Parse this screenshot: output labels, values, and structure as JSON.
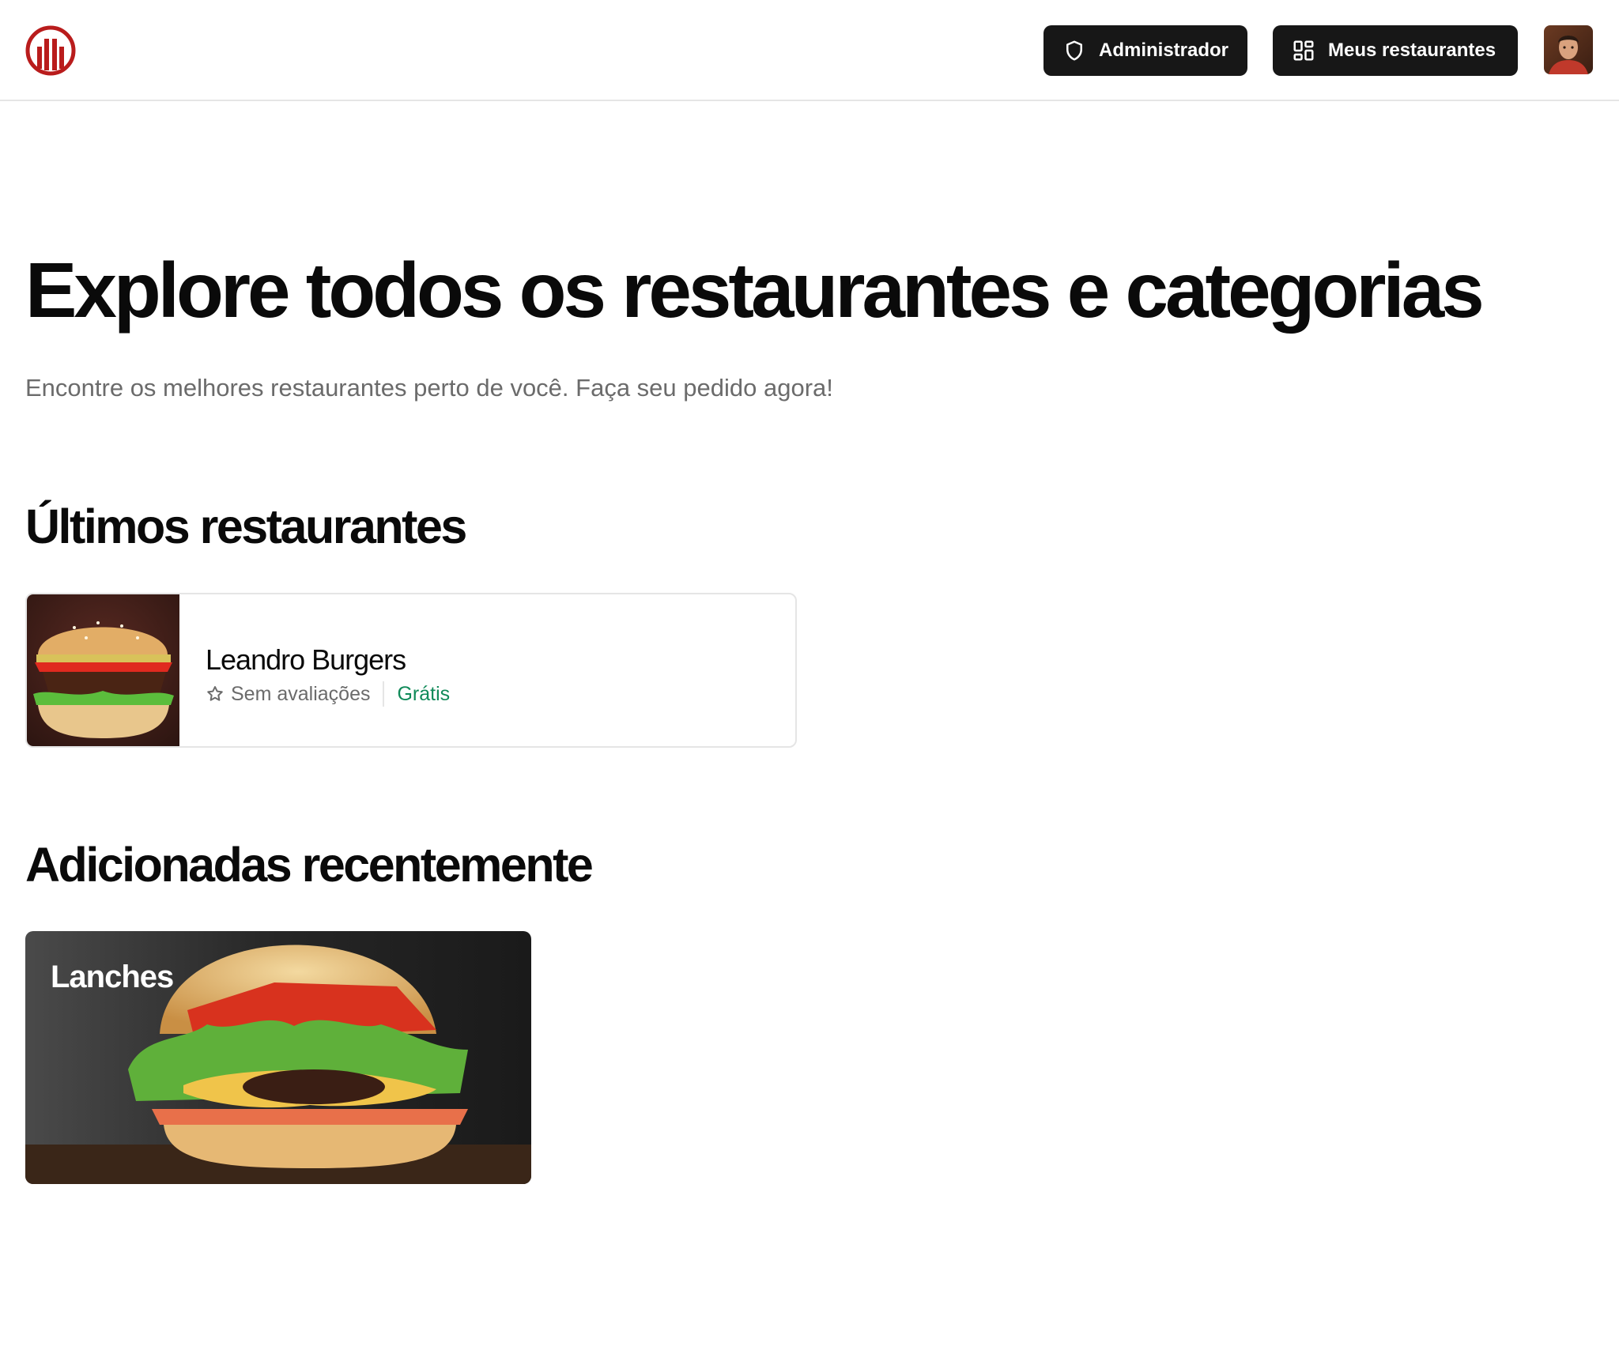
{
  "header": {
    "logo_icon": "bar-chart-circle-icon",
    "brand_color": "#b91c1c",
    "admin_button": {
      "label": "Administrador",
      "icon": "shield-icon"
    },
    "my_restaurants_button": {
      "label": "Meus restaurantes",
      "icon": "layout-grid-icon"
    },
    "avatar_icon": "user-avatar"
  },
  "hero": {
    "title": "Explore todos os restaurantes e categorias",
    "subtitle": "Encontre os melhores restaurantes perto de você. Faça seu pedido agora!"
  },
  "latest_restaurants": {
    "title": "Últimos restaurantes",
    "items": [
      {
        "name": "Leandro Burgers",
        "rating_label": "Sem avaliações",
        "delivery_fee": "Grátis",
        "image_icon": "burger-photo"
      }
    ]
  },
  "recent_categories": {
    "title": "Adicionadas recentemente",
    "items": [
      {
        "name": "Lanches",
        "image_icon": "burger-photo"
      }
    ]
  },
  "colors": {
    "button_bg": "#171717",
    "fee_green": "#108a59",
    "muted_text": "#6b6b6b"
  }
}
